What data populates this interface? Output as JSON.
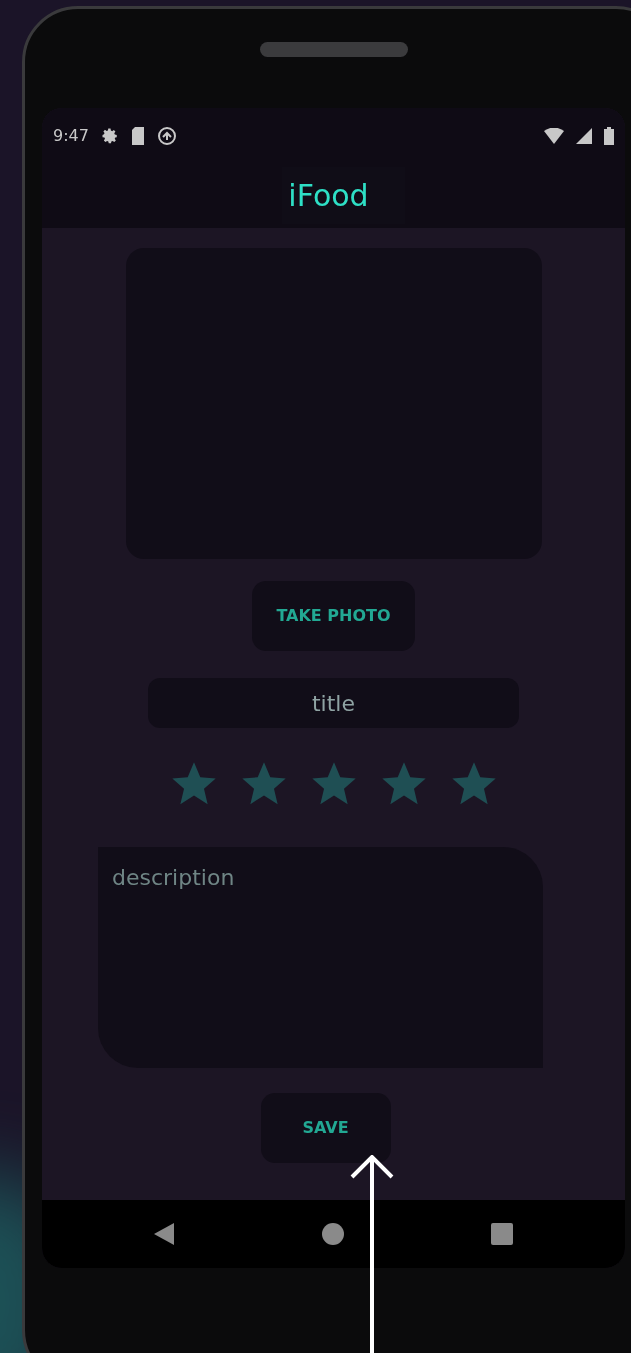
{
  "status_bar": {
    "time": "9:47"
  },
  "app_bar": {
    "title": "iFood"
  },
  "take_photo_button": {
    "label": "TAKE PHOTO"
  },
  "title_field": {
    "placeholder": "title"
  },
  "rating": {
    "stars": 5
  },
  "description_field": {
    "placeholder": "description"
  },
  "save_button": {
    "label": "SAVE"
  }
}
